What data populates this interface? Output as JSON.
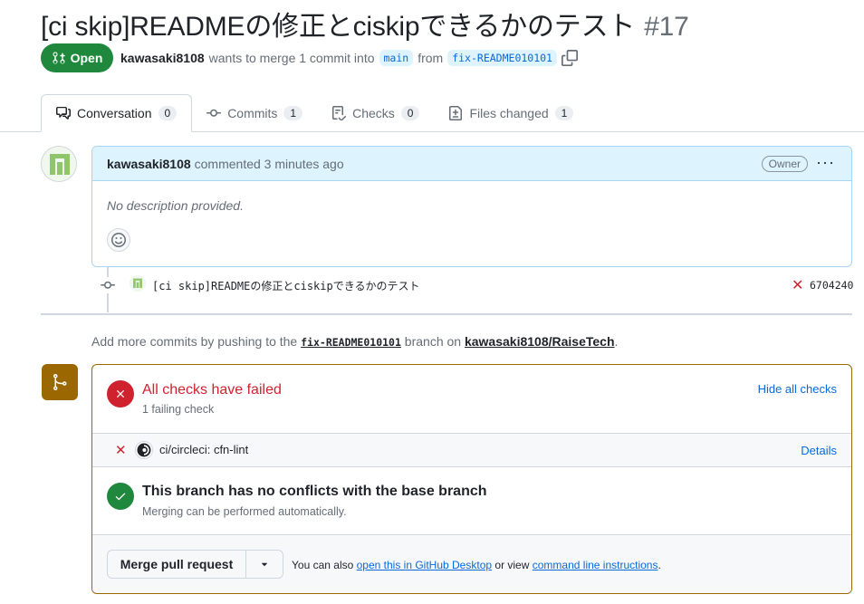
{
  "pr": {
    "title": "[ci skip]READMEの修正とciskipできるかのテスト",
    "number": "#17",
    "state": "Open",
    "author": "kawasaki8108",
    "action_text": "wants to merge 1 commit into",
    "base_branch": "main",
    "from_text": "from",
    "head_branch": "fix-README010101"
  },
  "tabs": [
    {
      "label": "Conversation",
      "count": "0",
      "icon": "comment-discussion-icon"
    },
    {
      "label": "Commits",
      "count": "1",
      "icon": "git-commit-icon"
    },
    {
      "label": "Checks",
      "count": "0",
      "icon": "checklist-icon"
    },
    {
      "label": "Files changed",
      "count": "1",
      "icon": "file-diff-icon"
    }
  ],
  "comment": {
    "author": "kawasaki8108",
    "meta": "commented 3 minutes ago",
    "badge": "Owner",
    "menu": "···",
    "body": "No description provided."
  },
  "commit": {
    "message": "[ci skip]READMEの修正とciskipできるかのテスト",
    "status": "✕",
    "sha": "6704240"
  },
  "push_hint": {
    "prefix": "Add more commits by pushing to the",
    "branch": "fix-README010101",
    "middle": "branch on",
    "repo": "kawasaki8108/RaiseTech",
    "suffix": "."
  },
  "checks": {
    "title": "All checks have failed",
    "subtitle": "1 failing check",
    "toggle": "Hide all checks",
    "item_status": "✕",
    "item_name": "ci/circleci: cfn-lint",
    "item_link": "Details"
  },
  "conflicts": {
    "title": "This branch has no conflicts with the base branch",
    "subtitle": "Merging can be performed automatically."
  },
  "merge": {
    "button": "Merge pull request",
    "hint_prefix": "You can also",
    "hint_link1": "open this in GitHub Desktop",
    "hint_middle": "or view",
    "hint_link2": "command line instructions",
    "hint_suffix": "."
  },
  "colors": {
    "open_green": "#1f883d",
    "fail_red": "#cf222e",
    "link_blue": "#0969da",
    "merge_amber": "#9a6700"
  }
}
